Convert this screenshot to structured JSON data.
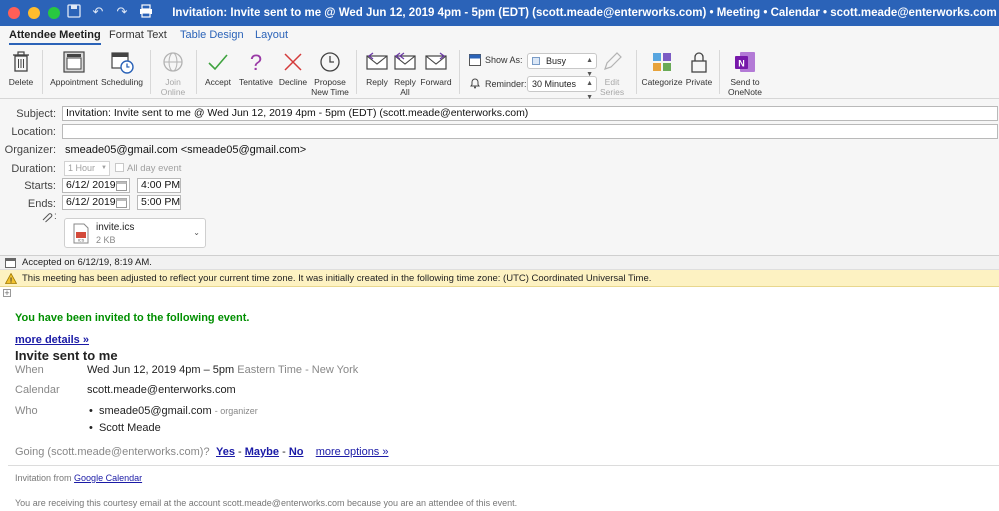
{
  "window": {
    "title": "Invitation: Invite sent to me @ Wed Jun 12, 2019 4pm - 5pm (EDT) (scott.meade@enterworks.com) • Meeting • Calendar • scott.meade@enterworks.com"
  },
  "tabs": [
    {
      "label": "Attendee Meeting",
      "active": true
    },
    {
      "label": "Format Text"
    },
    {
      "label": "Table Design"
    },
    {
      "label": "Layout"
    }
  ],
  "ribbon": {
    "delete": "Delete",
    "appointment": "Appointment",
    "scheduling": "Scheduling",
    "join_online": "Join Online",
    "accept": "Accept",
    "tentative": "Tentative",
    "decline": "Decline",
    "propose_new_time": "Propose New Time",
    "reply": "Reply",
    "reply_all": "Reply All",
    "forward": "Forward",
    "show_as_label": "Show As:",
    "show_as_value": "Busy",
    "reminder_label": "Reminder:",
    "reminder_value": "30 Minutes",
    "edit_series": "Edit Series",
    "categorize": "Categorize",
    "private": "Private",
    "send_to_onenote": "Send to OneNote"
  },
  "form": {
    "subject_label": "Subject:",
    "subject_value": "Invitation: Invite sent to me @ Wed Jun 12, 2019 4pm - 5pm (EDT) (scott.meade@enterworks.com)",
    "location_label": "Location:",
    "location_value": "",
    "organizer_label": "Organizer:",
    "organizer_value": "smeade05@gmail.com <smeade05@gmail.com>",
    "duration_label": "Duration:",
    "duration_value": "1 Hour",
    "all_day": "All day event",
    "starts_label": "Starts:",
    "start_date": "6/12/ 2019",
    "start_time": "4:00 PM",
    "ends_label": "Ends:",
    "end_date": "6/12/ 2019",
    "end_time": "5:00 PM",
    "attachment": {
      "name": "invite.ics",
      "size": "2 KB"
    }
  },
  "info": {
    "accepted": "Accepted on 6/12/19, 8:19 AM.",
    "timezone_notice": "This meeting has been adjusted to reflect your current time zone. It was initially created in the following time zone: (UTC) Coordinated Universal Time."
  },
  "body": {
    "invited": "You have been invited to the following event.",
    "more_details": "more details »",
    "event_title": "Invite sent to me",
    "when_label": "When",
    "when_value": "Wed Jun 12, 2019 4pm – 5pm",
    "when_tz": "Eastern Time - New York",
    "calendar_label": "Calendar",
    "calendar_value": "scott.meade@enterworks.com",
    "who_label": "Who",
    "who": [
      {
        "name": "smeade05@gmail.com",
        "role": "- organizer"
      },
      {
        "name": "Scott Meade",
        "role": ""
      }
    ],
    "going_label": "Going (scott.meade@enterworks.com)?",
    "yes": "Yes",
    "maybe": "Maybe",
    "no": "No",
    "sep": "-",
    "more_options": "more options »",
    "invitation_from": "Invitation from",
    "google_calendar": "Google Calendar",
    "courtesy": "You are receiving this courtesy email at the account scott.meade@enterworks.com because you are an attendee of this event."
  }
}
